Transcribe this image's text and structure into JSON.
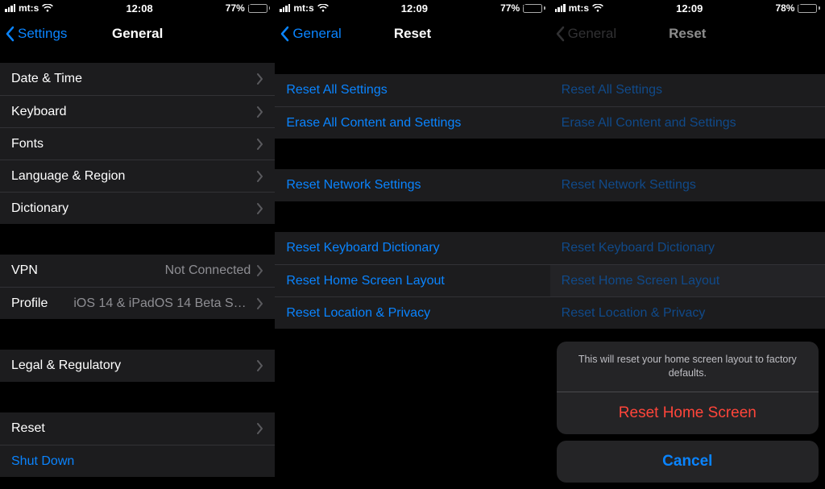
{
  "panels": [
    {
      "status": {
        "carrier": "mt:s",
        "time": "12:08",
        "battery_pct": "77%"
      },
      "nav": {
        "back": "Settings",
        "title": "General"
      },
      "s1": [
        {
          "label": "Date & Time"
        },
        {
          "label": "Keyboard"
        },
        {
          "label": "Fonts"
        },
        {
          "label": "Language & Region"
        },
        {
          "label": "Dictionary"
        }
      ],
      "s2": [
        {
          "label": "VPN",
          "value": "Not Connected"
        },
        {
          "label": "Profile",
          "value": "iOS 14 & iPadOS 14 Beta Softwar..."
        }
      ],
      "s3": [
        {
          "label": "Legal & Regulatory"
        }
      ],
      "s4": [
        {
          "label": "Reset"
        },
        {
          "label": "Shut Down"
        }
      ]
    },
    {
      "status": {
        "carrier": "mt:s",
        "time": "12:09",
        "battery_pct": "77%"
      },
      "nav": {
        "back": "General",
        "title": "Reset"
      },
      "r1": [
        {
          "label": "Reset All Settings"
        },
        {
          "label": "Erase All Content and Settings"
        }
      ],
      "r2": [
        {
          "label": "Reset Network Settings"
        }
      ],
      "r3": [
        {
          "label": "Reset Keyboard Dictionary"
        },
        {
          "label": "Reset Home Screen Layout"
        },
        {
          "label": "Reset Location & Privacy"
        }
      ]
    },
    {
      "status": {
        "carrier": "mt:s",
        "time": "12:09",
        "battery_pct": "78%"
      },
      "nav": {
        "back": "General",
        "title": "Reset"
      },
      "r1": [
        {
          "label": "Reset All Settings"
        },
        {
          "label": "Erase All Content and Settings"
        }
      ],
      "r2": [
        {
          "label": "Reset Network Settings"
        }
      ],
      "r3": [
        {
          "label": "Reset Keyboard Dictionary"
        },
        {
          "label": "Reset Home Screen Layout"
        },
        {
          "label": "Reset Location & Privacy"
        }
      ],
      "sheet": {
        "message": "This will reset your home screen layout to factory defaults.",
        "action": "Reset Home Screen",
        "cancel": "Cancel"
      }
    }
  ]
}
